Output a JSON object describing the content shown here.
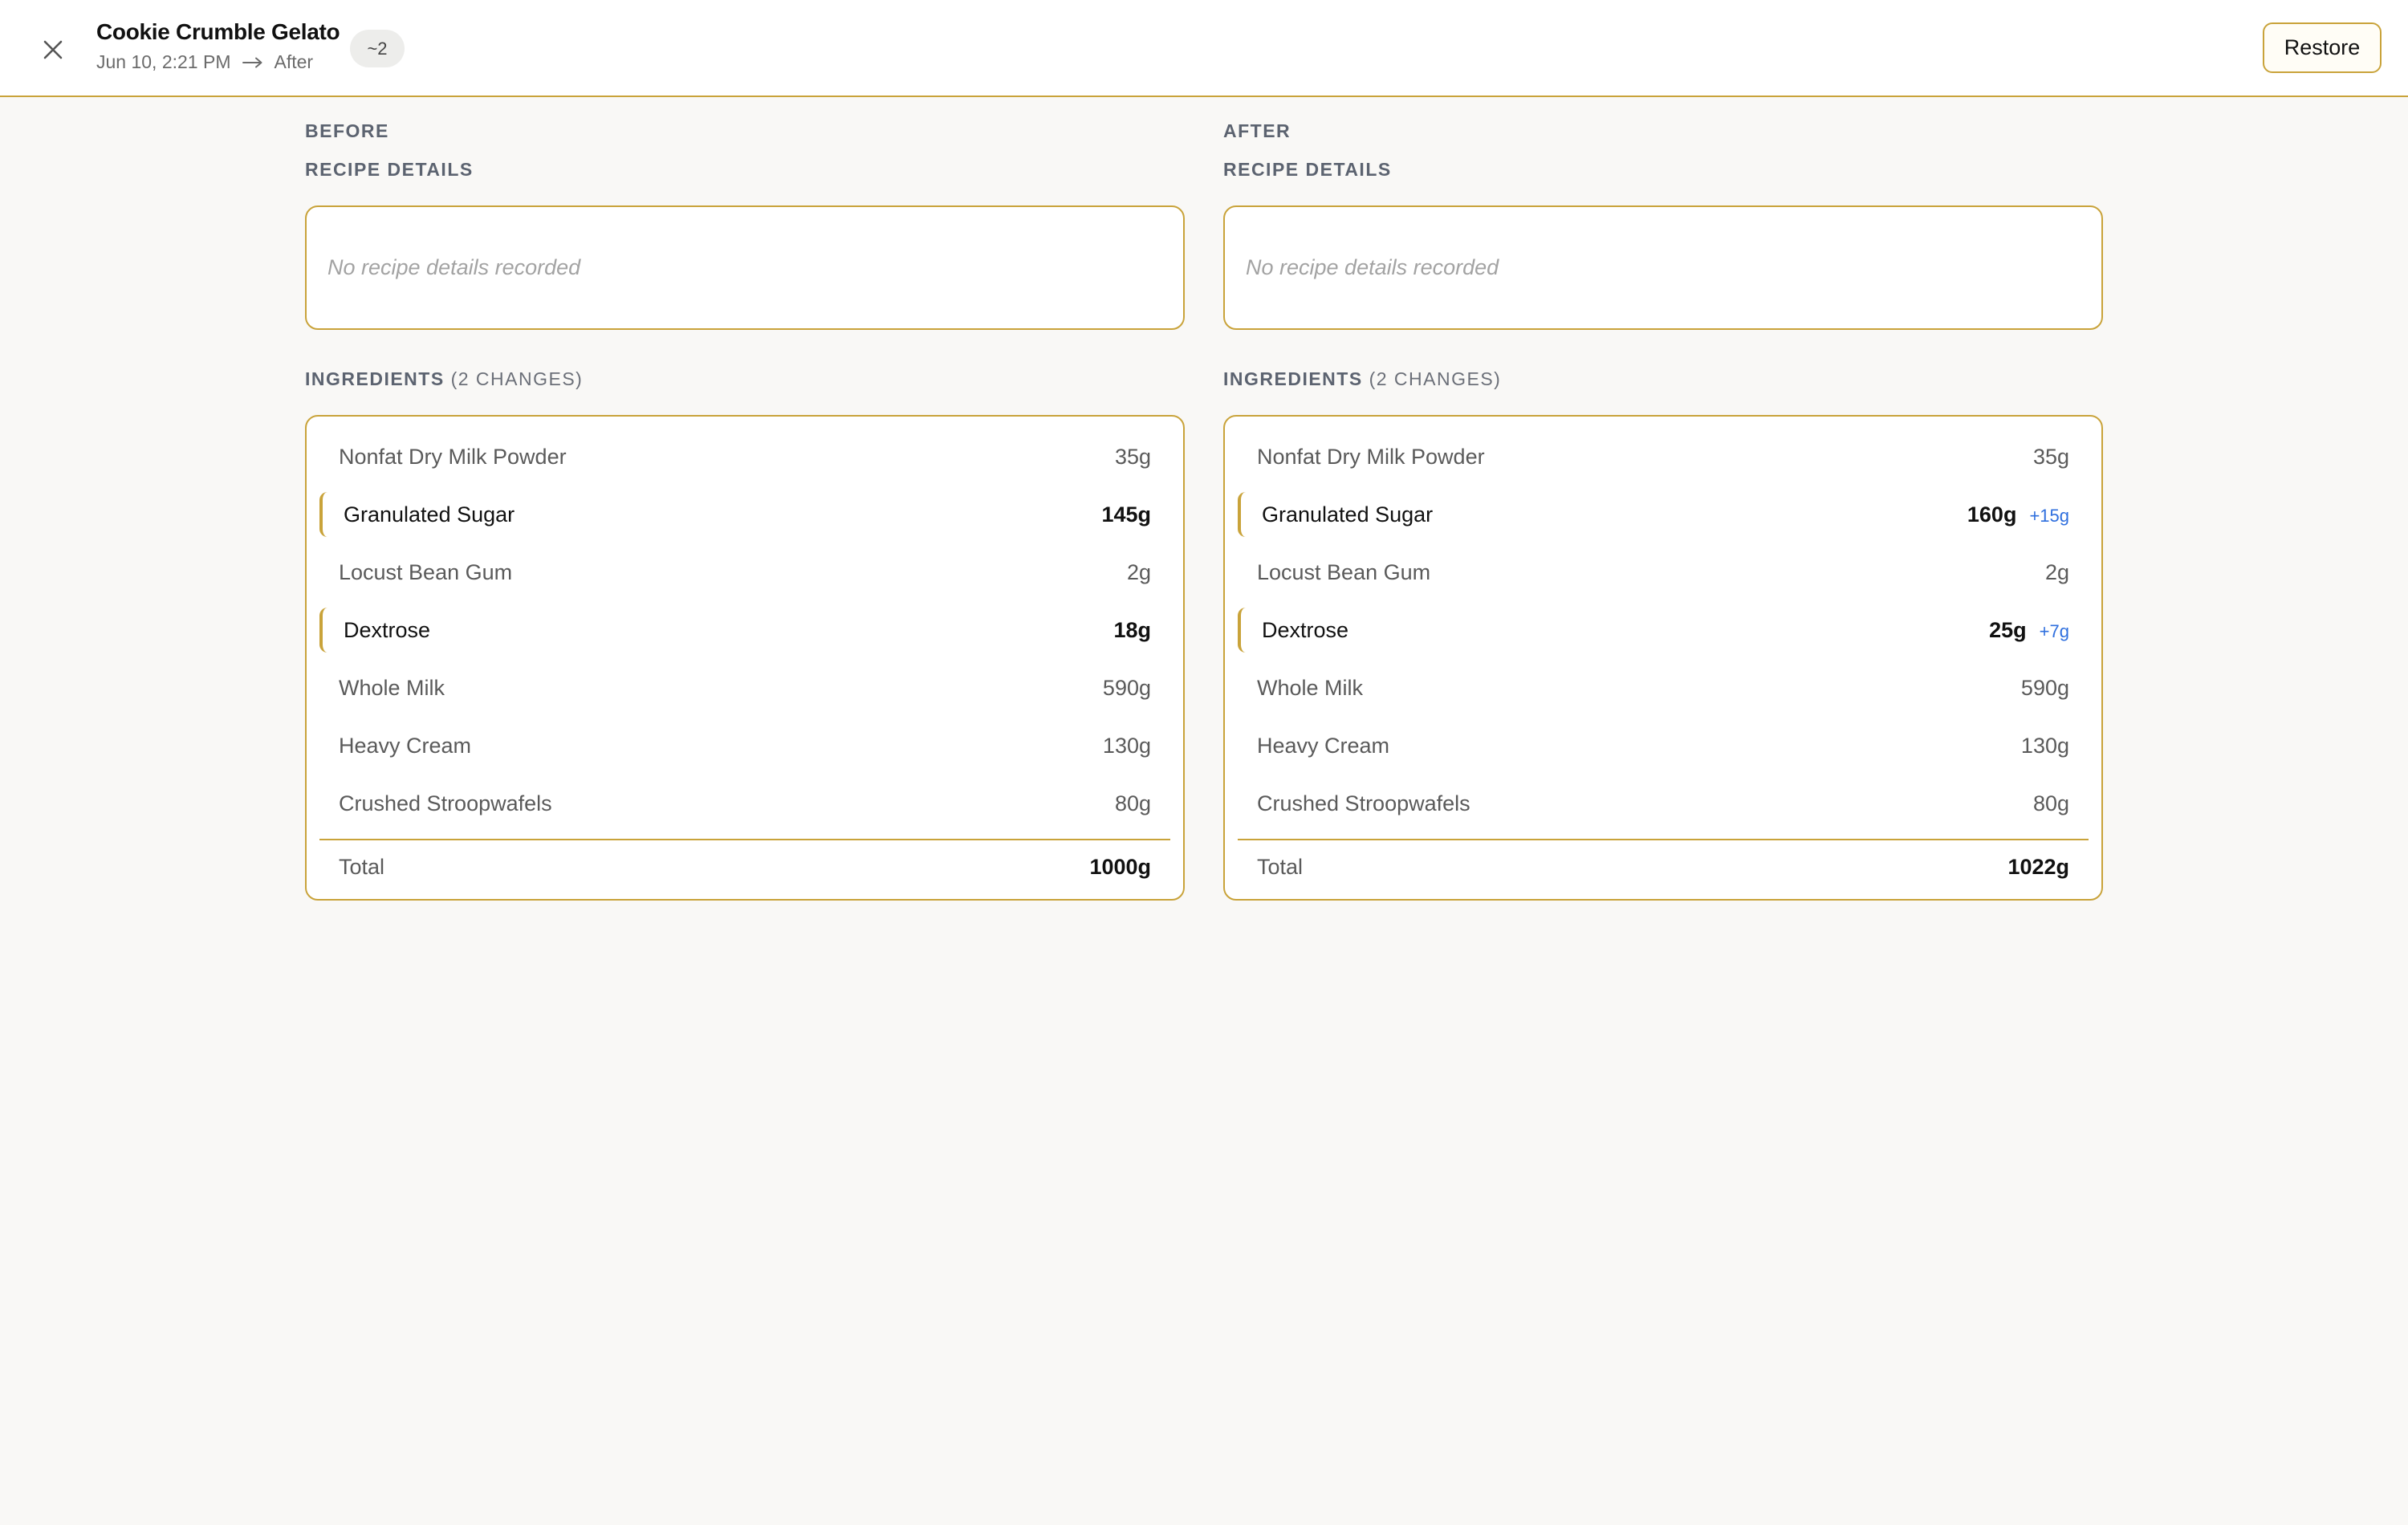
{
  "header": {
    "title": "Cookie Crumble Gelato",
    "from_time": "Jun 10, 2:21 PM",
    "to_label": "After",
    "change_badge": "~2",
    "restore_label": "Restore"
  },
  "before": {
    "heading": "BEFORE",
    "details_label": "RECIPE DETAILS",
    "details_empty": "No recipe details recorded",
    "ingredients_label": "INGREDIENTS",
    "ingredients_count": "(2 CHANGES)",
    "ingredients": [
      {
        "name": "Nonfat Dry Milk Powder",
        "amount": "35g"
      },
      {
        "name": "Granulated Sugar",
        "amount": "145g"
      },
      {
        "name": "Locust Bean Gum",
        "amount": "2g"
      },
      {
        "name": "Dextrose",
        "amount": "18g"
      },
      {
        "name": "Whole Milk",
        "amount": "590g"
      },
      {
        "name": "Heavy Cream",
        "amount": "130g"
      },
      {
        "name": "Crushed Stroopwafels",
        "amount": "80g"
      }
    ],
    "total_label": "Total",
    "total_value": "1000g"
  },
  "after": {
    "heading": "AFTER",
    "details_label": "RECIPE DETAILS",
    "details_empty": "No recipe details recorded",
    "ingredients_label": "INGREDIENTS",
    "ingredients_count": "(2 CHANGES)",
    "ingredients": [
      {
        "name": "Nonfat Dry Milk Powder",
        "amount": "35g"
      },
      {
        "name": "Granulated Sugar",
        "amount": "160g",
        "delta": "+15g"
      },
      {
        "name": "Locust Bean Gum",
        "amount": "2g"
      },
      {
        "name": "Dextrose",
        "amount": "25g",
        "delta": "+7g"
      },
      {
        "name": "Whole Milk",
        "amount": "590g"
      },
      {
        "name": "Heavy Cream",
        "amount": "130g"
      },
      {
        "name": "Crushed Stroopwafels",
        "amount": "80g"
      }
    ],
    "total_label": "Total",
    "total_value": "1022g"
  },
  "colors": {
    "accent": "#c9a33a",
    "delta": "#2f6fde",
    "background": "#f9f8f6"
  },
  "icons": [
    "close-icon",
    "arrow-right-icon"
  ]
}
